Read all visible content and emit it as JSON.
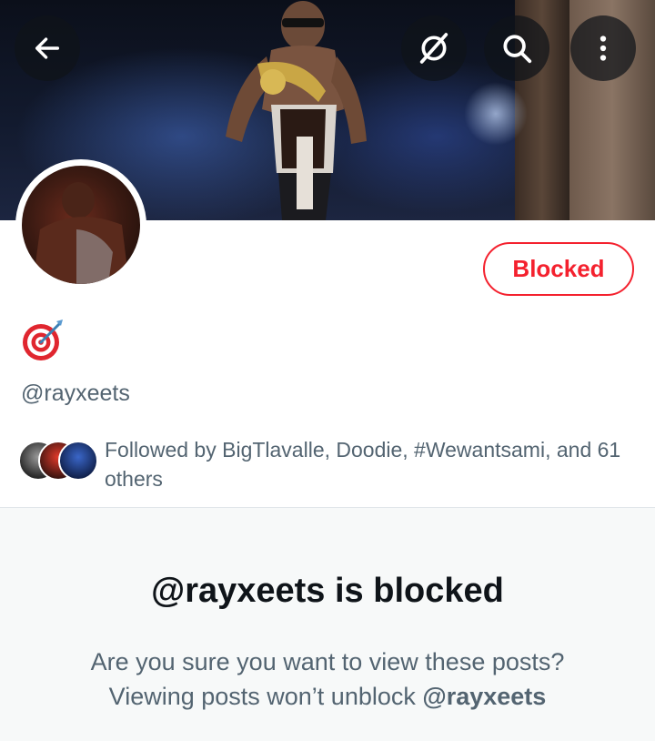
{
  "header": {
    "back_icon": "arrow-left-icon",
    "grok_icon": "grok-icon",
    "search_icon": "search-icon",
    "more_icon": "more-vertical-icon"
  },
  "profile": {
    "action_label": "Blocked",
    "bio_emoji": "🎯",
    "handle": "@rayxeets",
    "followed_by_text": "Followed by BigTlavalle, Doodie, #Wewantsami, and 61 others"
  },
  "blocked_notice": {
    "title": "@rayxeets is blocked",
    "line1": "Are you sure you want to view these posts?",
    "line2_prefix": "Viewing posts won’t unblock ",
    "line2_handle": "@rayxeets"
  },
  "colors": {
    "danger": "#f4212e",
    "secondary_text": "#536471",
    "primary_text": "#0f1419",
    "panel_bg": "#f7f9f9"
  }
}
